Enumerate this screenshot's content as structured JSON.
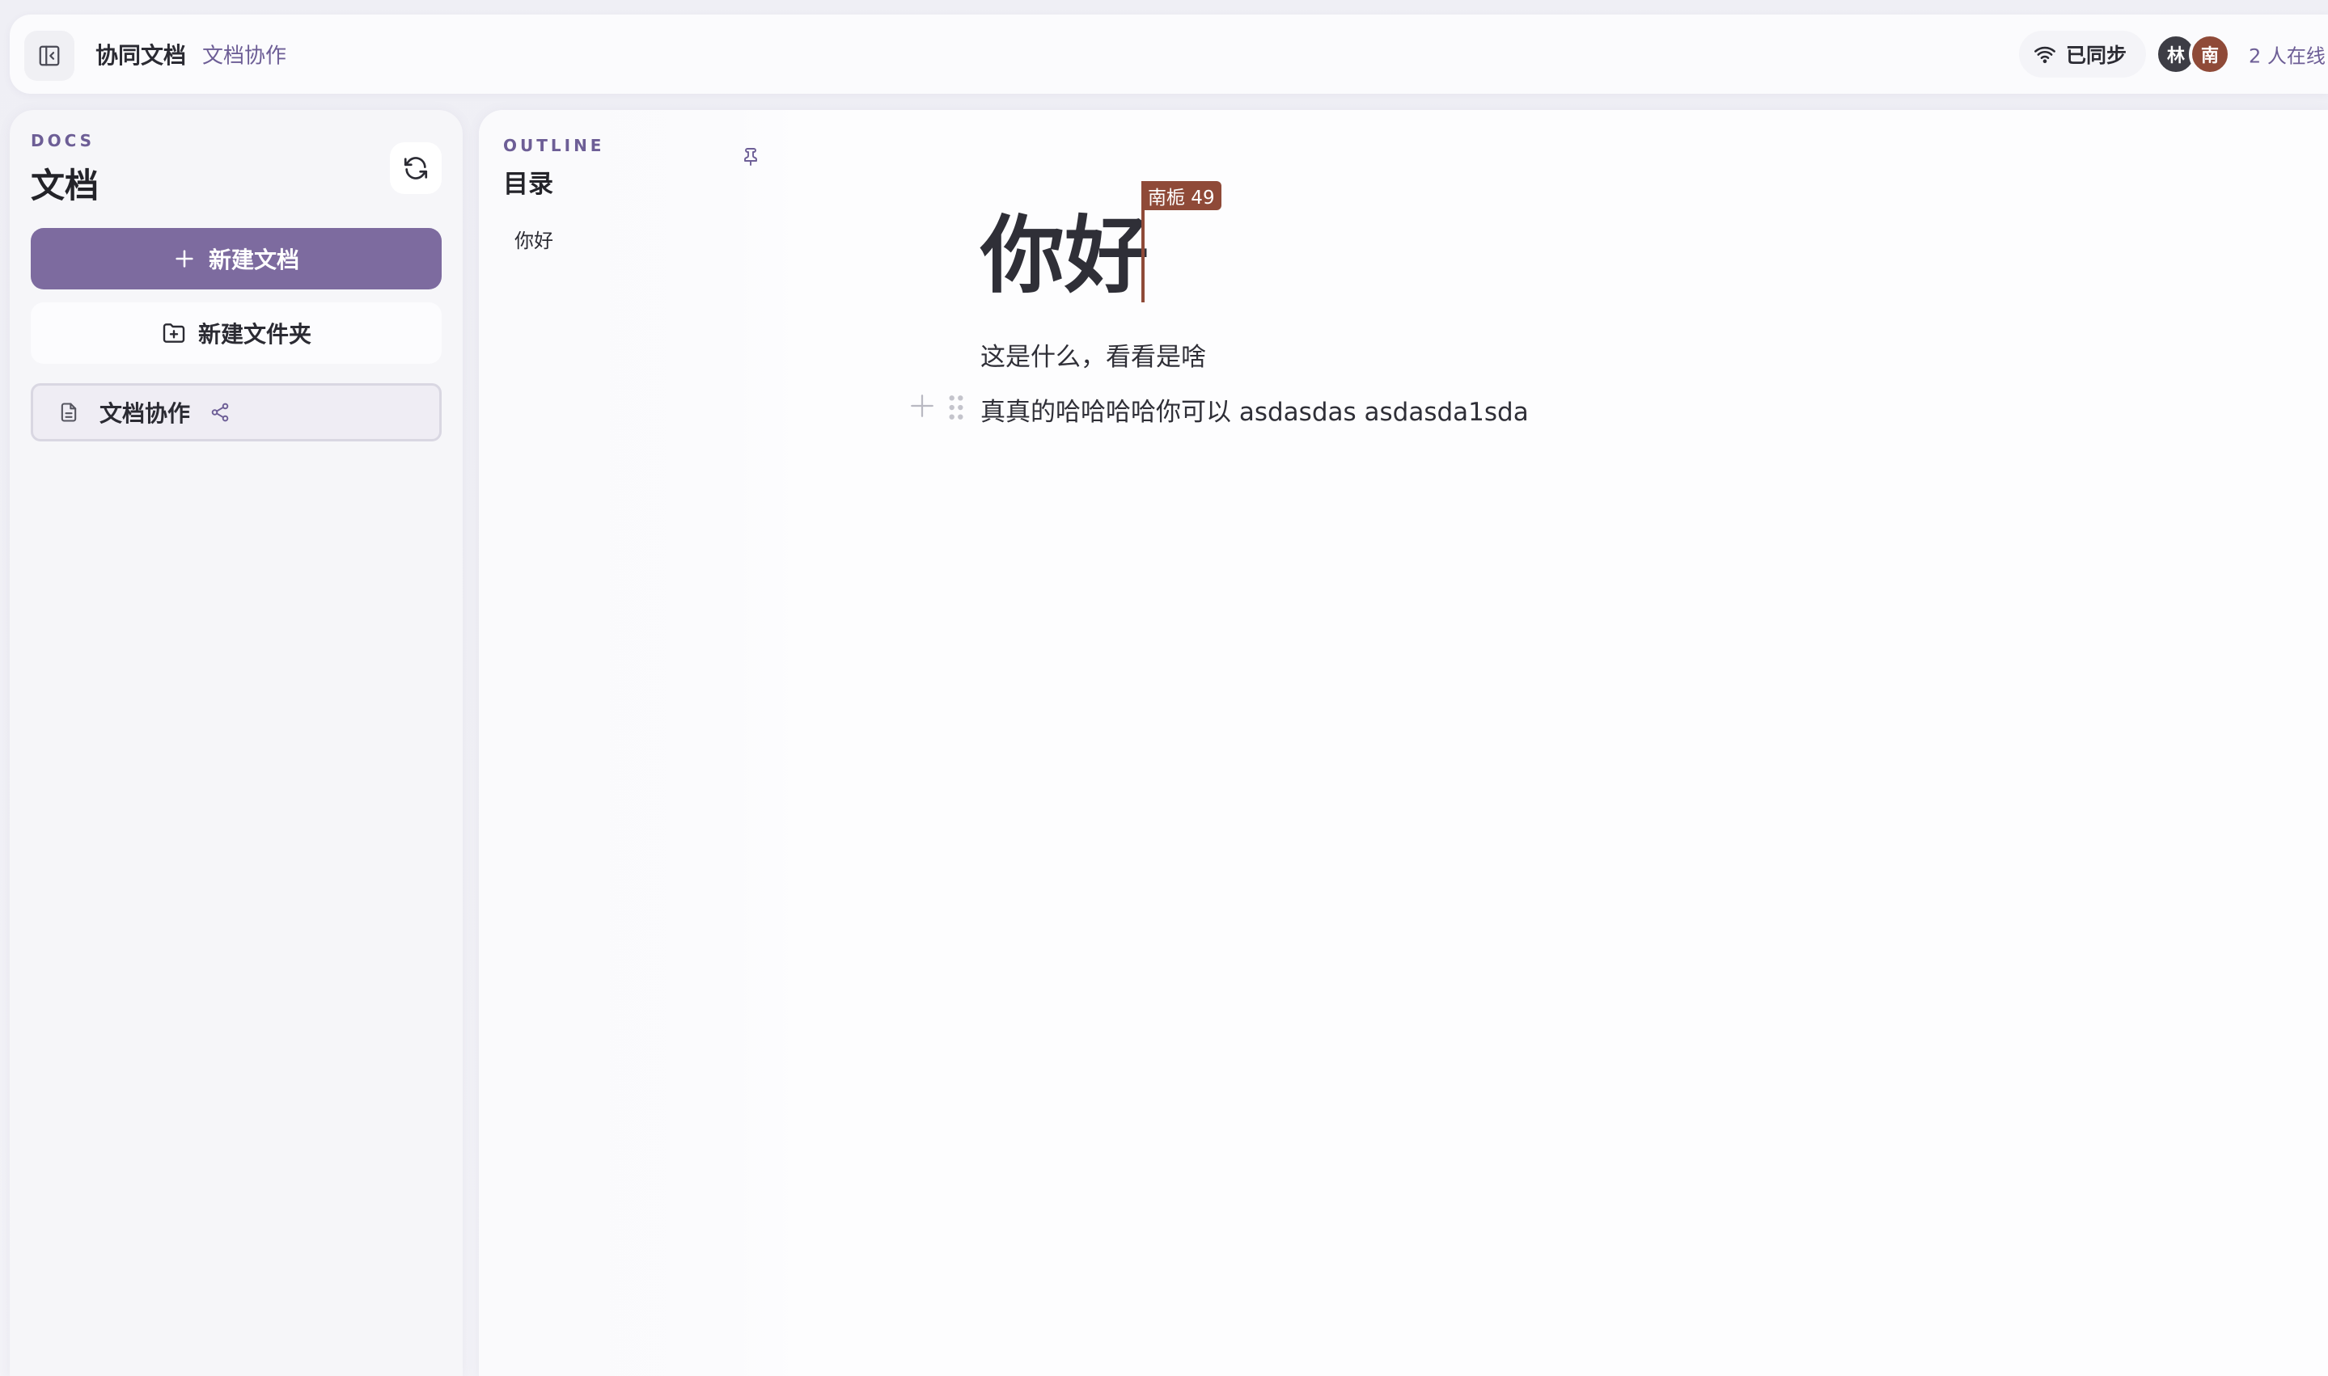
{
  "header": {
    "title": "协同文档",
    "subtitle": "文档协作",
    "sync_status": "已同步",
    "users": [
      {
        "initial": "林",
        "color": "#3d3d45"
      },
      {
        "initial": "南",
        "color": "#8f4a38"
      }
    ],
    "online_count": "2 人在线"
  },
  "sidebar": {
    "eyebrow": "DOCS",
    "heading": "文档",
    "new_doc_label": "新建文档",
    "new_folder_label": "新建文件夹",
    "documents": [
      {
        "label": "文档协作"
      }
    ]
  },
  "outline": {
    "eyebrow": "OUTLINE",
    "heading": "目录",
    "items": [
      "你好"
    ]
  },
  "editor": {
    "heading": "你好",
    "remote_cursor_label": "南栀 49",
    "paragraphs": [
      "这是什么，看看是啥",
      "真真的哈哈哈哈你可以 asdasdas asdasda1sda"
    ]
  },
  "colors": {
    "accent": "#7d6b9f",
    "accent_text": "#6d5e96",
    "remote_cursor": "#8f4a38"
  },
  "icons": {
    "sidebar_toggle": "panel-left-close-icon",
    "sync": "wifi-icon",
    "refresh": "refresh-icon",
    "new_doc": "plus-icon",
    "new_folder": "folder-plus-icon",
    "document": "file-text-icon",
    "share": "share-icon",
    "pin": "pin-icon",
    "block_add": "plus-icon",
    "block_drag": "drag-handle-icon"
  }
}
